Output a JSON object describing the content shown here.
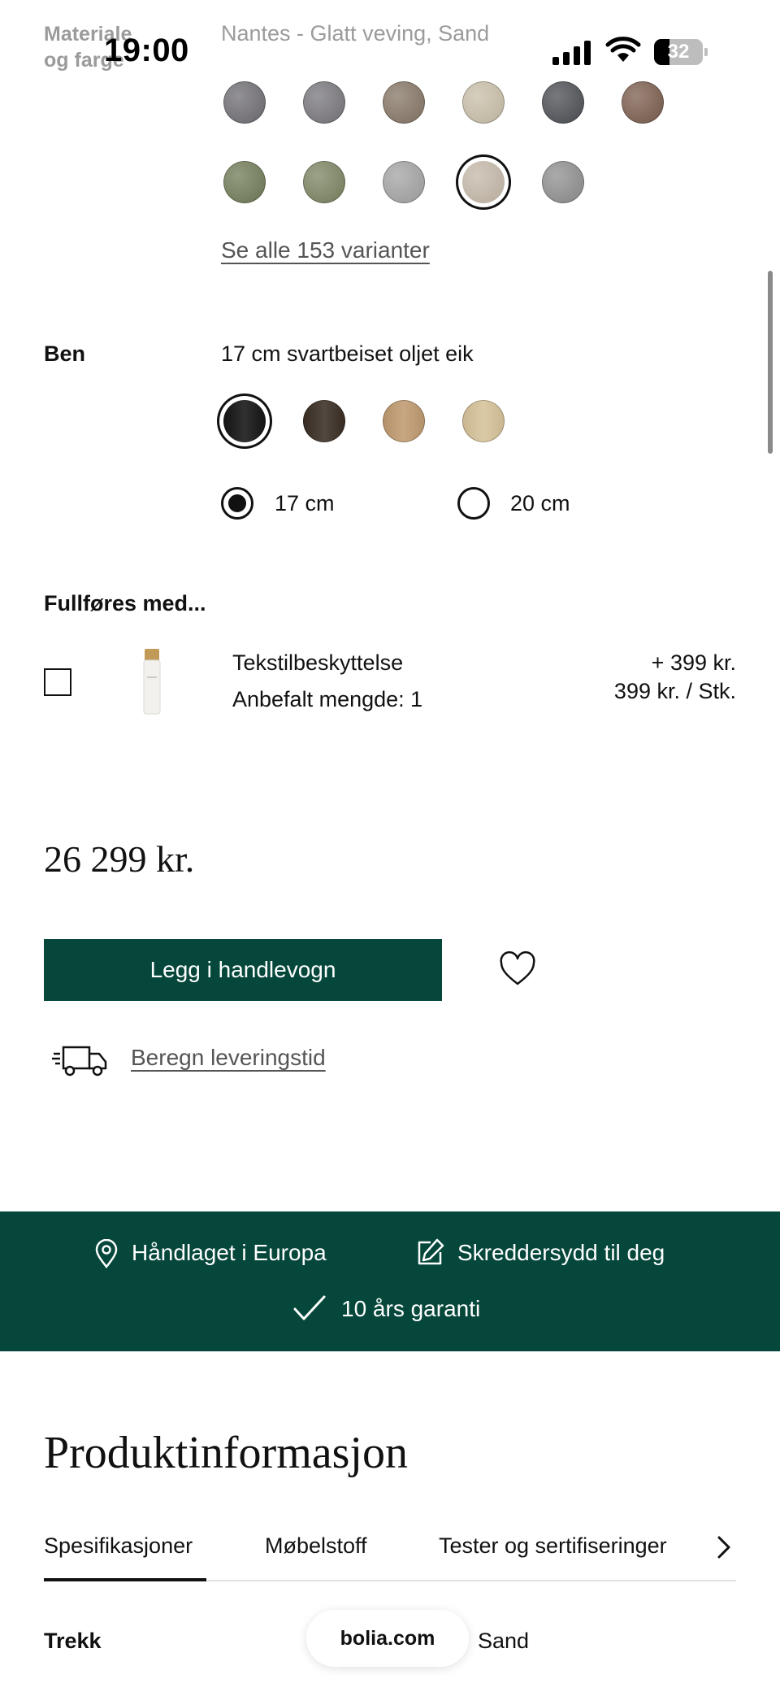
{
  "status_bar": {
    "time": "19:00",
    "battery": "32",
    "battery_level": 0.32
  },
  "material": {
    "label_line1": "Materiale",
    "label_line2": "og farge",
    "selected_value": "Nantes - Glatt veving, Sand",
    "see_all_link": "Se alle 153 varianter",
    "swatches_row1": [
      "#6e6c72",
      "#77757a",
      "#857565",
      "#c9bfa8",
      "#4a4d52",
      "#7a5c4c"
    ],
    "swatches_row2": [
      "#6f7a55",
      "#7a8360",
      "#a3a3a3",
      "#c4b8a8",
      "#8e8e8e"
    ],
    "selected_index": 9
  },
  "legs": {
    "label": "Ben",
    "selected_value": "17 cm svartbeiset oljet eik",
    "swatches": [
      "#141414",
      "#3a2e24",
      "#bf9a70",
      "#d6c29a"
    ],
    "selected_index": 0,
    "height_options": [
      "17 cm",
      "20 cm"
    ],
    "selected_height": "17 cm"
  },
  "complete_with": {
    "heading": "Fullføres med...",
    "item_name": "Tekstilbeskyttelse",
    "item_recommended": "Anbefalt mengde: 1",
    "item_price_add": "+ 399 kr.",
    "item_unit_price": "399 kr. / Stk."
  },
  "purchase": {
    "price": "26 299 kr.",
    "add_to_cart": "Legg i handlevogn",
    "delivery_link": "Beregn leveringstid"
  },
  "usp_band": {
    "item1": "Håndlaget i Europa",
    "item2": "Skreddersydd til deg",
    "item3": "10 års garanti"
  },
  "product_info": {
    "title": "Produktinformasjon",
    "tabs": [
      "Spesifikasjoner",
      "Møbelstoff",
      "Tester og sertifiseringer"
    ],
    "active_tab": "Spesifikasjoner",
    "row_label": "Trekk",
    "row_value": "Sand"
  },
  "browser": {
    "url": "bolia.com"
  },
  "icons": {
    "signal": "signal-bars-icon",
    "wifi": "wifi-icon",
    "battery": "battery-icon",
    "heart": "heart-icon",
    "truck": "truck-icon",
    "location": "location-pin-icon",
    "edit": "edit-icon",
    "check": "check-icon",
    "chevron": "chevron-right-icon"
  }
}
